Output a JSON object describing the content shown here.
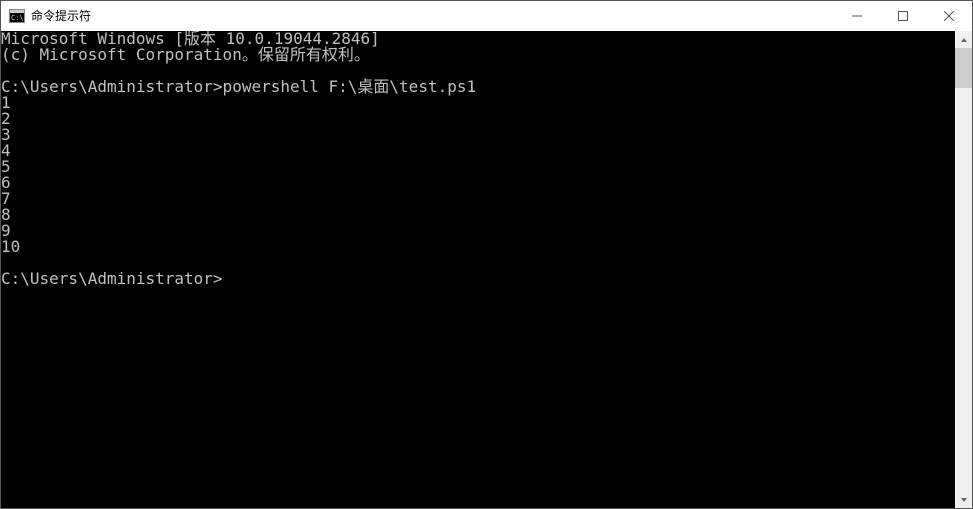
{
  "window": {
    "title": "命令提示符"
  },
  "terminal": {
    "lines": [
      "Microsoft Windows [版本 10.0.19044.2846]",
      "(c) Microsoft Corporation。保留所有权利。",
      "",
      "C:\\Users\\Administrator>powershell F:\\桌面\\test.ps1",
      "1",
      "2",
      "3",
      "4",
      "5",
      "6",
      "7",
      "8",
      "9",
      "10",
      "",
      "C:\\Users\\Administrator>"
    ]
  }
}
